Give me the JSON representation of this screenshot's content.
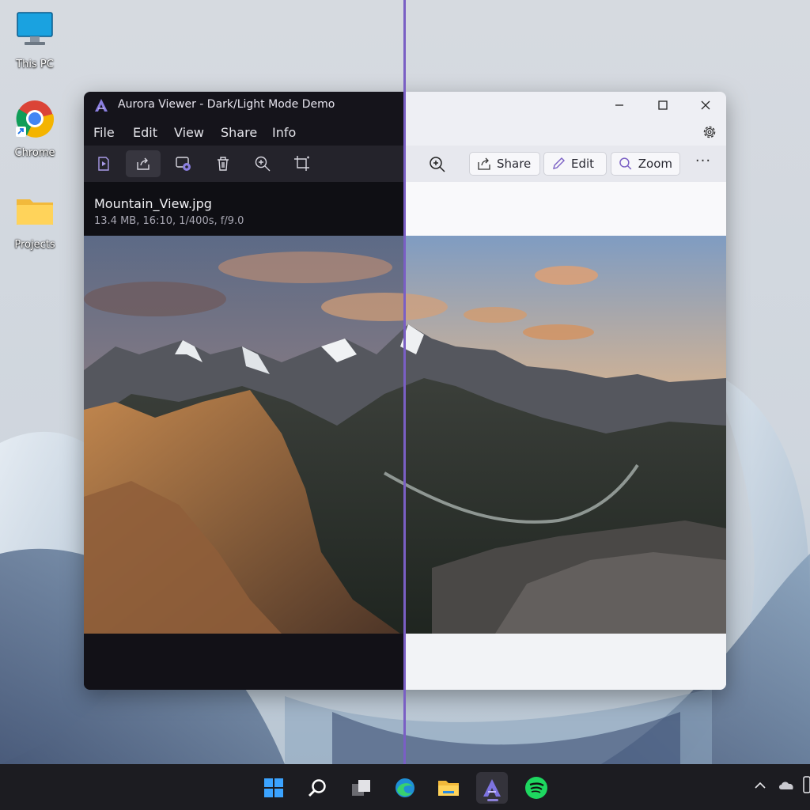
{
  "desktop": {
    "icons": [
      {
        "label": "This PC",
        "icon": "monitor-icon"
      },
      {
        "label": "Chrome",
        "icon": "chrome-icon"
      },
      {
        "label": "Projects",
        "icon": "folder-icon"
      }
    ]
  },
  "window": {
    "title": "Aurora Viewer - Dark/Light Mode Demo",
    "menu": [
      "File",
      "Edit",
      "View",
      "Share",
      "Info"
    ],
    "dark_toolbar_icons": [
      "slideshow-icon",
      "share-icon",
      "slideshow-settings-icon",
      "delete-icon",
      "zoom-in-icon",
      "crop-icon"
    ],
    "file": {
      "name": "Mountain_View.jpg",
      "size": "13.4 MB,",
      "aspect": "16:10,",
      "shutter": "1/400s,",
      "aperture": "f/9.0"
    },
    "light_toolbar": {
      "share_label": "Share",
      "edit_label": "Edit",
      "zoom_label": "Zoom",
      "more_label": "···"
    },
    "controls": [
      "minimize-icon",
      "maximize-icon",
      "close-icon",
      "settings-gear-icon"
    ]
  },
  "taskbar": {
    "apps": [
      "windows-start-icon",
      "search-icon",
      "task-view-icon",
      "edge-icon",
      "file-explorer-icon",
      "aurora-viewer-icon",
      "spotify-icon"
    ],
    "tray": [
      "chevron-up-icon",
      "cloud-icon"
    ]
  },
  "colors": {
    "accent": "#7a5fc4",
    "dark_bg": "#15141b",
    "light_bg": "#eeeff4",
    "taskbar": "#1c1c21"
  }
}
